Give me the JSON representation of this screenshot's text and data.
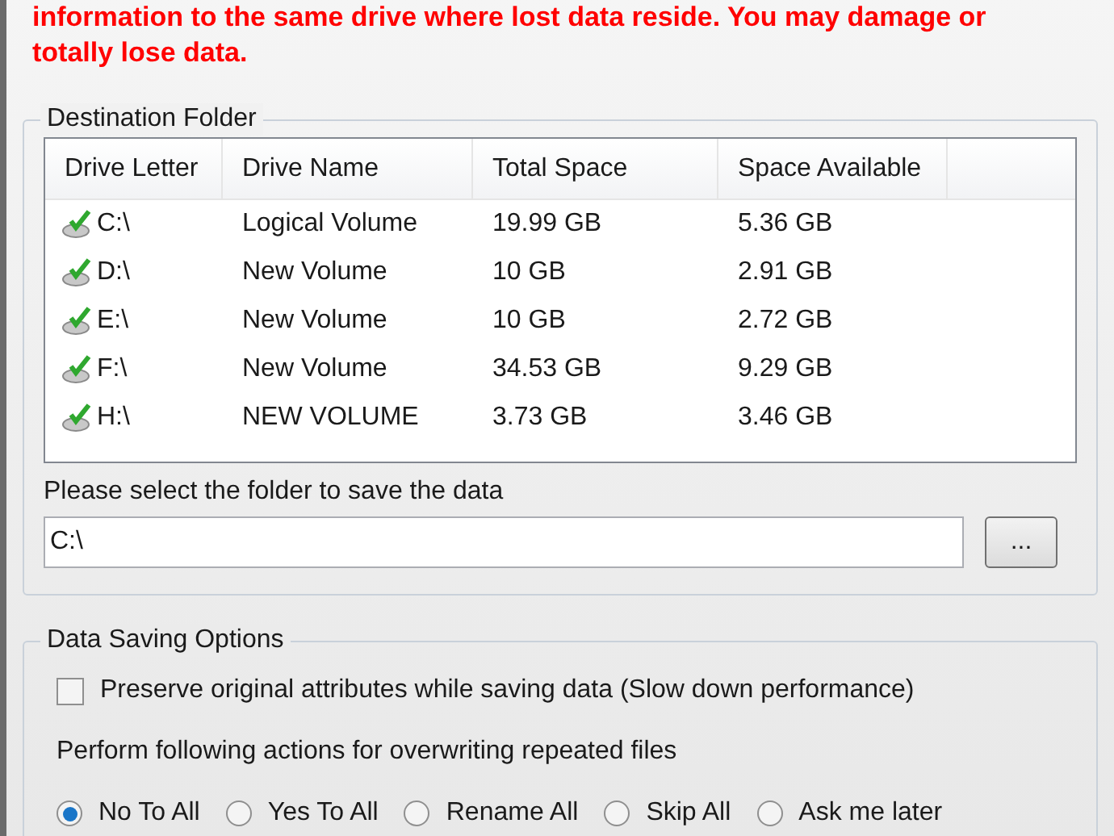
{
  "warning": "information to the same drive where lost data reside. You may damage or totally lose data.",
  "destination": {
    "title": "Destination Folder",
    "columns": [
      "Drive Letter",
      "Drive Name",
      "Total Space",
      "Space Available"
    ],
    "rows": [
      {
        "cells": [
          "C:\\",
          "Logical Volume",
          "19.99 GB",
          "5.36 GB"
        ]
      },
      {
        "cells": [
          "D:\\",
          "New Volume",
          "10 GB",
          "2.91 GB"
        ]
      },
      {
        "cells": [
          "E:\\",
          "New Volume",
          "10 GB",
          "2.72 GB"
        ]
      },
      {
        "cells": [
          "F:\\",
          "New Volume",
          "34.53 GB",
          "9.29 GB"
        ]
      },
      {
        "cells": [
          "H:\\",
          "NEW VOLUME",
          "3.73 GB",
          "3.46 GB"
        ]
      }
    ],
    "folder_label": "Please select the folder to save the data",
    "folder_value": "C:\\",
    "browse_button": "..."
  },
  "options": {
    "title": "Data Saving Options",
    "preserve": {
      "label": "Preserve original attributes while saving data (Slow down performance)",
      "checked": false
    },
    "actions_label": "Perform following actions for overwriting repeated files",
    "actions": [
      {
        "label": "No To All",
        "selected": true
      },
      {
        "label": "Yes To All",
        "selected": false
      },
      {
        "label": "Rename All",
        "selected": false
      },
      {
        "label": "Skip All",
        "selected": false
      },
      {
        "label": "Ask me later",
        "selected": false
      }
    ]
  }
}
